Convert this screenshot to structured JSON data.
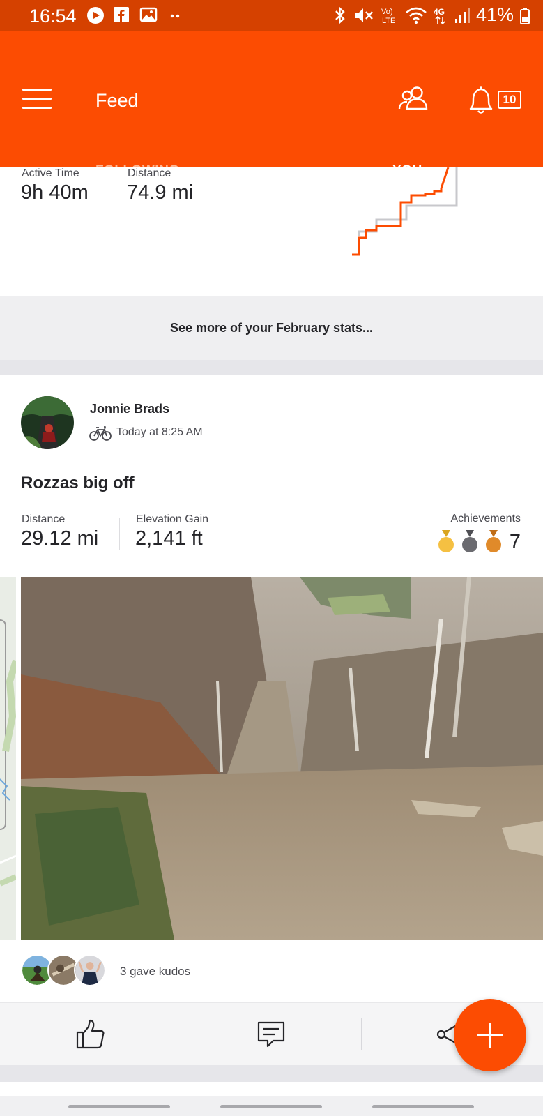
{
  "status_bar": {
    "time": "16:54",
    "battery": "41%",
    "icons": [
      "youtube-icon",
      "facebook-icon",
      "gallery-icon",
      "more-dots-icon",
      "bluetooth-icon",
      "mute-icon",
      "volte-icon",
      "wifi-icon",
      "4g-icon",
      "signal-icon",
      "battery-icon"
    ]
  },
  "app_bar": {
    "title": "Feed",
    "notification_count": "10",
    "tabs": [
      {
        "label": "FOLLOWING",
        "active": false
      },
      {
        "label": "YOU",
        "active": true
      }
    ]
  },
  "stats_card": {
    "active_time_label": "Active Time",
    "active_time_value": "9h 40m",
    "distance_label": "Distance",
    "distance_value": "74.9 mi",
    "see_more": "See more of your February stats..."
  },
  "activity": {
    "athlete_name": "Jonnie Brads",
    "timestamp": "Today at 8:25 AM",
    "title": "Rozzas big off",
    "distance_label": "Distance",
    "distance_value": "29.12 mi",
    "elevation_label": "Elevation Gain",
    "elevation_value": "2,141 ft",
    "achievements_label": "Achievements",
    "achievements_count": "7",
    "kudos_text": "3 gave kudos"
  },
  "colors": {
    "brand": "#fc4c02",
    "status_bar": "#d54100",
    "medal_gold": "#f5c042",
    "medal_silver": "#6b6b70",
    "medal_bronze": "#e08a2a"
  }
}
